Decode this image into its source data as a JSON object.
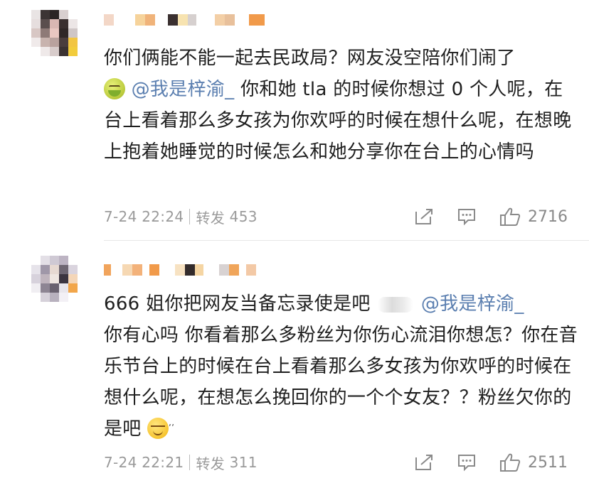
{
  "comments": [
    {
      "text_part1": "你们俩能不能一起去民政局？网友没空陪你们闹了",
      "mention": "@我是梓渝_",
      "text_part2": " 你和她 tla 的时候你想过 0 个人呢，在台上看着那么多女孩为你欢呼的时候在想什么呢，在想晚上抱着她睡觉的时候怎么和她分享你在台上的心情吗",
      "emoji": "nauseated-face-icon",
      "timestamp": "7-24 22:24",
      "repost_label": "转发",
      "repost_count": "453",
      "like_count": "2716"
    },
    {
      "text_part1": "666 姐你把网友当备忘录使是吧",
      "mention": "@我是梓渝_",
      "text_part2": "你有心吗 你看着那么多粉丝为你伤心流泪你想怎？你在音乐节台上的时候在台上看着那么多女孩为你欢呼的时候在想什么呢，在想怎么挽回你的一个个女友？？粉丝欠你的是吧",
      "emoji": "smirking-sweat-face-icon",
      "timestamp": "7-24 22:21",
      "repost_label": "转发",
      "repost_count": "311",
      "like_count": "2511"
    }
  ],
  "icons": [
    "share-icon",
    "comment-icon",
    "like-icon"
  ],
  "colors": {
    "mention": "#5b7fb0",
    "meta": "#9a9a9a",
    "text": "#1f1f1f"
  }
}
